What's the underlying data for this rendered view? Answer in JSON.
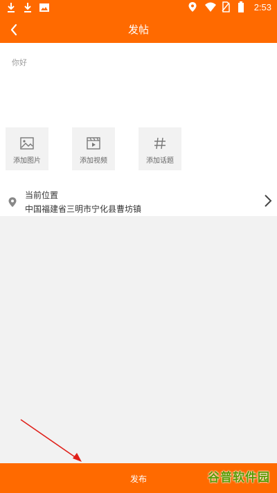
{
  "status_bar": {
    "time": "2:53",
    "icons": [
      "download-icon",
      "download-icon",
      "image-icon",
      "location-icon",
      "wifi-icon",
      "no-sim-icon",
      "battery-icon"
    ]
  },
  "toolbar": {
    "title": "发帖",
    "back_icon": "chevron-left-icon"
  },
  "editor": {
    "placeholder": "你好"
  },
  "tiles": [
    {
      "label": "添加图片",
      "icon": "image-icon"
    },
    {
      "label": "添加视频",
      "icon": "video-icon"
    },
    {
      "label": "添加话题",
      "icon": "hashtag-icon"
    }
  ],
  "location": {
    "title": "当前位置",
    "address": "中国福建省三明市宁化县曹坊镇",
    "icon": "location-pin-icon"
  },
  "publish": {
    "label": "发布"
  },
  "watermark": {
    "text": "谷普软件园"
  },
  "colors": {
    "accent": "#ff6a00",
    "background_gray": "#f2f2f2",
    "annotation_arrow": "#e0201a",
    "watermark": "#5a9a00"
  }
}
